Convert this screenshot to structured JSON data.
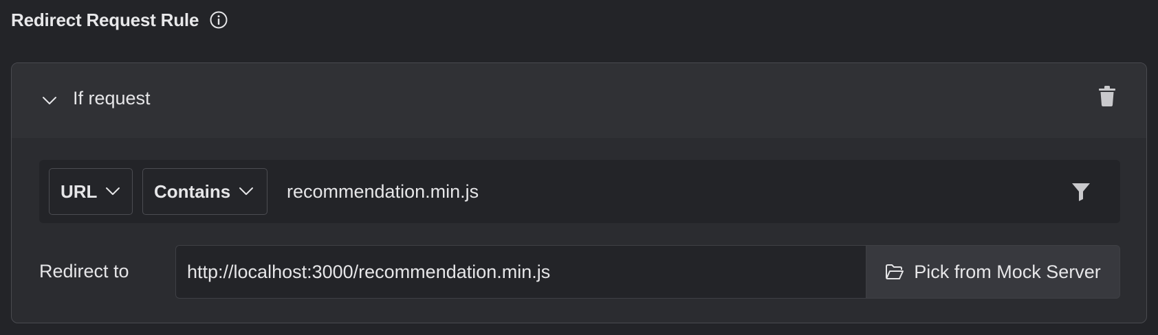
{
  "header": {
    "title": "Redirect Request Rule",
    "info_icon": "info-circle-icon"
  },
  "rule_card": {
    "section_title": "If request",
    "collapse_icon": "chevron-down-icon",
    "delete_icon": "trash-icon",
    "condition": {
      "source_selected": "URL",
      "operator_selected": "Contains",
      "value": "recommendation.min.js",
      "filter_icon": "filter-icon"
    },
    "redirect": {
      "label": "Redirect to",
      "value": "http://localhost:3000/recommendation.min.js",
      "pick_button_label": "Pick from Mock Server",
      "pick_icon": "folder-open-icon"
    }
  },
  "colors": {
    "background": "#232428",
    "card": "#2b2c30",
    "card_header": "#303135",
    "border": "#4a4b50",
    "text": "#e6e6e8",
    "icon": "#c9c9cc"
  }
}
